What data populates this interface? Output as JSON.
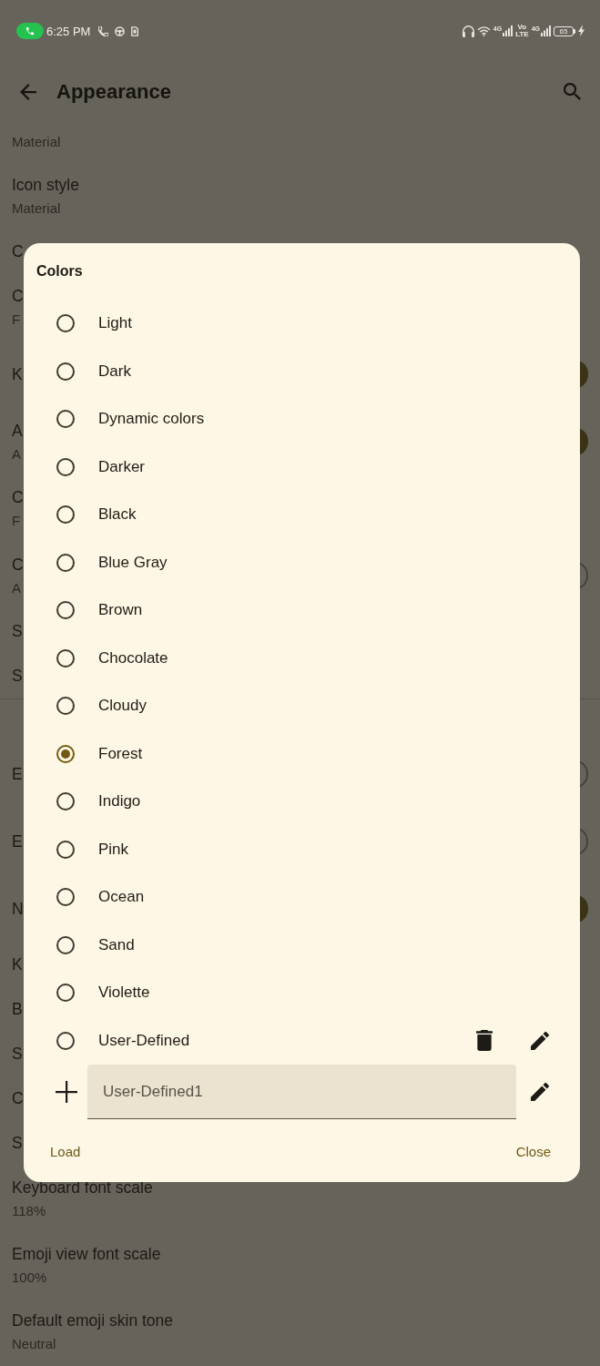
{
  "status_bar": {
    "time": "6:25 PM",
    "indicators": [
      {
        "kind": "signal",
        "label": "4G"
      },
      {
        "kind": "volte",
        "lines": [
          "Vo",
          "LTE"
        ]
      },
      {
        "kind": "signal",
        "label": "4G"
      }
    ],
    "battery": "65",
    "charging": true
  },
  "app_bar": {
    "title": "Appearance"
  },
  "settings": {
    "sections": [
      {
        "rows": [
          {
            "subtitle": "Material"
          },
          {
            "title": "Icon style",
            "subtitle": "Material"
          },
          {
            "title": "C"
          },
          {
            "title": "C",
            "subtitle": "F"
          },
          {
            "title": "K",
            "switch": {
              "on": true
            }
          },
          {
            "title": "A",
            "subtitle": "A",
            "switch": {
              "on": true
            }
          },
          {
            "title": "C",
            "subtitle": "F"
          },
          {
            "title": "C",
            "subtitle": "A",
            "switch": {
              "on": false
            }
          },
          {
            "title": "S"
          },
          {
            "title": "S"
          }
        ]
      },
      {
        "rows": [
          {
            "title": "E",
            "switch": {
              "on": false
            }
          },
          {
            "title": "E",
            "switch": {
              "on": false
            }
          },
          {
            "title": "N",
            "switch": {
              "on": true
            }
          },
          {
            "title": "K"
          },
          {
            "title": "B"
          },
          {
            "title": "S"
          },
          {
            "title": "C"
          },
          {
            "title": "S"
          },
          {
            "title": "Keyboard font scale",
            "subtitle": "118%"
          },
          {
            "title": "Emoji view font scale",
            "subtitle": "100%"
          },
          {
            "title": "Default emoji skin tone",
            "subtitle": "Neutral"
          }
        ]
      }
    ]
  },
  "dialog": {
    "title": "Colors",
    "options": [
      {
        "label": "Light",
        "selected": false,
        "kind": "preset"
      },
      {
        "label": "Dark",
        "selected": false,
        "kind": "preset"
      },
      {
        "label": "Dynamic colors",
        "selected": false,
        "kind": "preset"
      },
      {
        "label": "Darker",
        "selected": false,
        "kind": "preset"
      },
      {
        "label": "Black",
        "selected": false,
        "kind": "preset"
      },
      {
        "label": "Blue Gray",
        "selected": false,
        "kind": "preset"
      },
      {
        "label": "Brown",
        "selected": false,
        "kind": "preset"
      },
      {
        "label": "Chocolate",
        "selected": false,
        "kind": "preset"
      },
      {
        "label": "Cloudy",
        "selected": false,
        "kind": "preset"
      },
      {
        "label": "Forest",
        "selected": true,
        "kind": "preset"
      },
      {
        "label": "Indigo",
        "selected": false,
        "kind": "preset"
      },
      {
        "label": "Pink",
        "selected": false,
        "kind": "preset"
      },
      {
        "label": "Ocean",
        "selected": false,
        "kind": "preset"
      },
      {
        "label": "Sand",
        "selected": false,
        "kind": "preset"
      },
      {
        "label": "Violette",
        "selected": false,
        "kind": "preset"
      },
      {
        "label": "User-Defined",
        "selected": false,
        "kind": "custom"
      }
    ],
    "new_theme_field": {
      "value": "User-Defined1"
    },
    "buttons": [
      {
        "label": "Load"
      },
      {
        "label": "Close"
      }
    ]
  }
}
